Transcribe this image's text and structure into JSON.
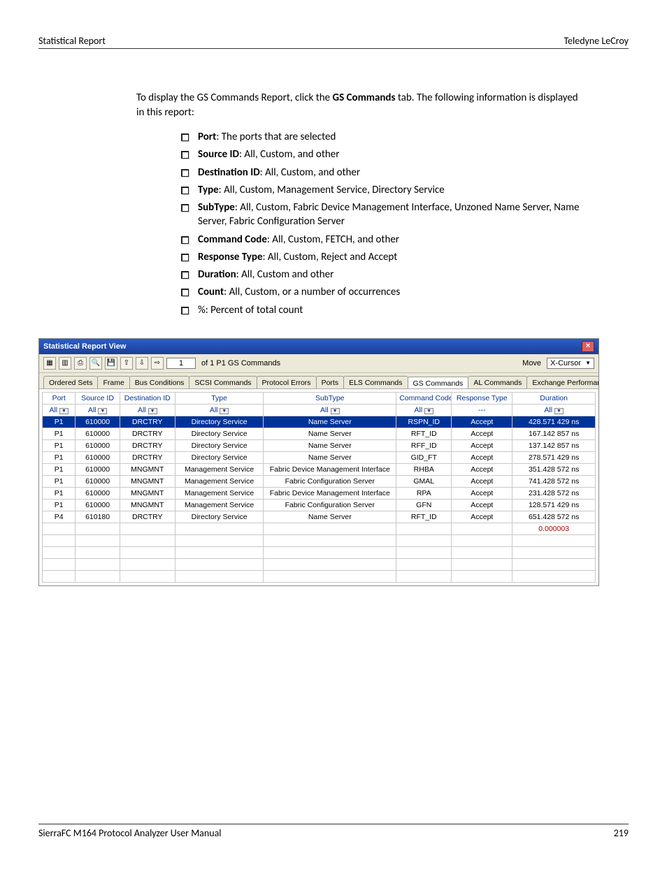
{
  "header": {
    "left": "Statistical Report",
    "right": "Teledyne LeCroy"
  },
  "intro": {
    "pre": "To display the GS Commands Report, click the ",
    "strong": "GS Commands",
    "post": " tab. The following information is displayed in this report:"
  },
  "bullets": [
    {
      "term": "Port",
      "desc": ": The ports that are selected"
    },
    {
      "term": "Source ID",
      "desc": ": All, Custom, and other"
    },
    {
      "term": "Destination ID",
      "desc": ": All, Custom, and other"
    },
    {
      "term": "Type",
      "desc": ": All, Custom, Management Service, Directory Service"
    },
    {
      "term": "SubType",
      "desc": ": All, Custom, Fabric Device Management Interface, Unzoned Name Server, Name Server, Fabric Configuration Server"
    },
    {
      "term": "Command Code",
      "desc": ": All, Custom, FETCH, and other"
    },
    {
      "term": "Response Type",
      "desc": ": All, Custom, Reject and Accept"
    },
    {
      "term": "Duration",
      "desc": ": All, Custom and other"
    },
    {
      "term": "Count",
      "desc": ": All, Custom, or a number of occurrences"
    },
    {
      "term": "",
      "desc": "%: Percent of total count"
    }
  ],
  "window": {
    "title": "Statistical Report View",
    "toolbar": {
      "page_field": "1",
      "page_info": "of 1  P1  GS Commands",
      "move_label": "Move",
      "move_select": "X-Cursor"
    },
    "tabs": [
      "Ordered Sets",
      "Frame",
      "Bus Conditions",
      "SCSI Commands",
      "Protocol Errors",
      "Ports",
      "ELS Commands",
      "GS Commands",
      "AL Commands",
      "Exchange Performance"
    ],
    "active_tab": "GS Commands",
    "columns": [
      "Port",
      "Source ID",
      "Destination ID",
      "Type",
      "SubType",
      "Command Code",
      "Response Type",
      "Duration"
    ],
    "filters": {
      "port": "All",
      "src": "All",
      "dst": "All",
      "type": "All",
      "sub": "All",
      "cmd": "All",
      "resp": "---",
      "dur": "All"
    },
    "rows": [
      {
        "hl": true,
        "port": "P1",
        "src": "610000",
        "dst": "DRCTRY",
        "type": "Directory Service",
        "sub": "Name Server",
        "cmd": "RSPN_ID",
        "resp": "Accept",
        "dur": "428.571 429",
        "unit": "ns"
      },
      {
        "port": "P1",
        "src": "610000",
        "dst": "DRCTRY",
        "type": "Directory Service",
        "sub": "Name Server",
        "cmd": "RFT_ID",
        "resp": "Accept",
        "dur": "167.142 857",
        "unit": "ns"
      },
      {
        "port": "P1",
        "src": "610000",
        "dst": "DRCTRY",
        "type": "Directory Service",
        "sub": "Name Server",
        "cmd": "RFF_ID",
        "resp": "Accept",
        "dur": "137.142 857",
        "unit": "ns"
      },
      {
        "port": "P1",
        "src": "610000",
        "dst": "DRCTRY",
        "type": "Directory Service",
        "sub": "Name Server",
        "cmd": "GID_FT",
        "resp": "Accept",
        "dur": "278.571 429",
        "unit": "ns"
      },
      {
        "port": "P1",
        "src": "610000",
        "dst": "MNGMNT",
        "type": "Management Service",
        "sub": "Fabric Device Management Interface",
        "cmd": "RHBA",
        "resp": "Accept",
        "dur": "351.428 572",
        "unit": "ns"
      },
      {
        "port": "P1",
        "src": "610000",
        "dst": "MNGMNT",
        "type": "Management Service",
        "sub": "Fabric Configuration Server",
        "cmd": "GMAL",
        "resp": "Accept",
        "dur": "741.428 572",
        "unit": "ns"
      },
      {
        "port": "P1",
        "src": "610000",
        "dst": "MNGMNT",
        "type": "Management Service",
        "sub": "Fabric Device Management Interface",
        "cmd": "RPA",
        "resp": "Accept",
        "dur": "231.428 572",
        "unit": "ns"
      },
      {
        "port": "P1",
        "src": "610000",
        "dst": "MNGMNT",
        "type": "Management Service",
        "sub": "Fabric Configuration Server",
        "cmd": "GFN",
        "resp": "Accept",
        "dur": "128.571 429",
        "unit": "ns"
      },
      {
        "port": "P4",
        "src": "610180",
        "dst": "DRCTRY",
        "type": "Directory Service",
        "sub": "Name Server",
        "cmd": "RFT_ID",
        "resp": "Accept",
        "dur": "651.428 572",
        "unit": "ns"
      }
    ],
    "footer_value": "0.000003"
  },
  "footer": {
    "left": "SierraFC M164 Protocol Analyzer User Manual",
    "right": "219"
  }
}
